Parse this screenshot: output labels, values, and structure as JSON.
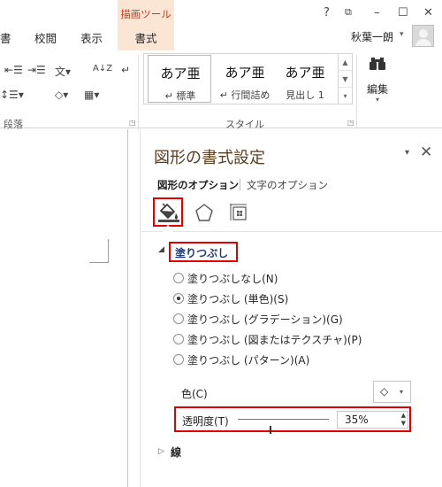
{
  "ribbon": {
    "tabs": [
      {
        "label": "書"
      },
      {
        "label": "校閲"
      },
      {
        "label": "表示"
      }
    ],
    "contextual_tool_title": "描画ツール",
    "contextual_tab": "書式",
    "window_controls": {
      "help": "?",
      "restore": "⧉",
      "minimize": "–",
      "maximize": "☐",
      "close": "✕"
    },
    "user_name": "秋葉一朗",
    "user_caret": "▾",
    "paragraph_group_label": "段落",
    "styles_group_label": "スタイル",
    "launcher_glyph": "◳",
    "paragraph_icons": {
      "outdent": "⇤☰",
      "indent": "⇥☰",
      "asian_layout": "文▾",
      "sort": "A↓Z",
      "mark": "↵",
      "line_spacing": "↕☰▾",
      "shading": "◇▾",
      "borders": "▦▾"
    },
    "styles": [
      {
        "sample": "あア亜",
        "name": "↵ 標準"
      },
      {
        "sample": "あア亜",
        "name": "↵ 行間詰め"
      },
      {
        "sample": "あア亜",
        "name": "見出し 1"
      }
    ],
    "gallery_scroll": [
      "▲",
      "▼",
      "▾"
    ],
    "edit": {
      "icon": "🔍",
      "label": "編集",
      "caret": "▾"
    }
  },
  "pane": {
    "title": "図形の書式設定",
    "caret": "▾",
    "close": "✕",
    "tabs": {
      "shape": "図形のオプション",
      "text": "文字のオプション"
    },
    "fill": {
      "heading_triangle": "◢",
      "heading": "塗りつぶし",
      "options": [
        {
          "label": "塗りつぶしなし(N)",
          "selected": false
        },
        {
          "label": "塗りつぶし (単色)(S)",
          "selected": true
        },
        {
          "label": "塗りつぶし (グラデーション)(G)",
          "selected": false
        },
        {
          "label": "塗りつぶし (図またはテクスチャ)(P)",
          "selected": false
        },
        {
          "label": "塗りつぶし (パターン)(A)",
          "selected": false
        }
      ],
      "color_label": "色(C)",
      "color_button_icon": "◇",
      "color_button_caret": "▾",
      "transparency_label": "透明度(T)",
      "transparency_value": "35%",
      "transparency_fraction": 0.35,
      "spin_up": "▲",
      "spin_down": "▼"
    },
    "line": {
      "heading_triangle": "▷",
      "heading": "線"
    }
  },
  "colors": {
    "accent_red": "#e00000",
    "pane_title": "#5a3d1f",
    "fill_heading": "#1e3a78",
    "contextual_band": "#fbe6d6",
    "contextual_title": "#c43e1c"
  }
}
